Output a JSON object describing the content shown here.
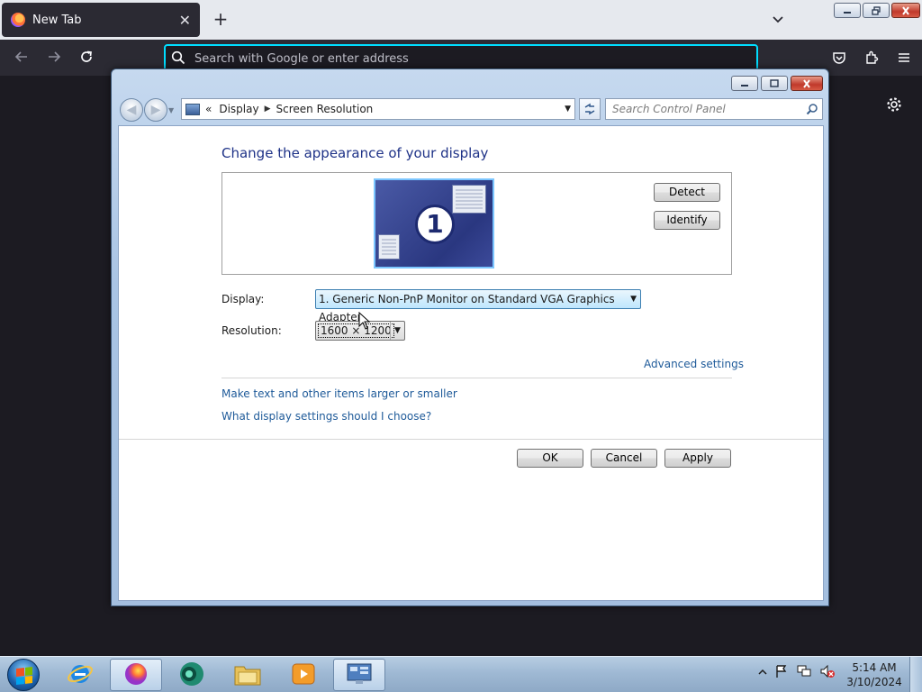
{
  "browser": {
    "tab_title": "New Tab",
    "tab_close": "✕",
    "new_tab_label": "+",
    "url_placeholder": "Search with Google or enter address"
  },
  "window": {
    "breadcrumb": [
      "«",
      "Display",
      "Screen Resolution"
    ],
    "search_placeholder": "Search Control Panel"
  },
  "content": {
    "title": "Change the appearance of your display",
    "monitor_number": "1",
    "detect_label": "Detect",
    "identify_label": "Identify",
    "display_label": "Display:",
    "display_value": "1. Generic Non-PnP Monitor on Standard VGA Graphics Adapter",
    "resolution_label": "Resolution:",
    "resolution_value": "1600 × 1200",
    "advanced_link": "Advanced settings",
    "link_text_size": "Make text and other items larger or smaller",
    "link_what_settings": "What display settings should I choose?",
    "ok_label": "OK",
    "cancel_label": "Cancel",
    "apply_label": "Apply"
  },
  "taskbar": {
    "apps": [
      "internet-explorer",
      "firefox",
      "media-center",
      "windows-explorer",
      "media-player",
      "control-panel"
    ],
    "time": "5:14 AM",
    "date": "3/10/2024"
  },
  "colors": {
    "browser_dark": "#2b2a33",
    "url_focus": "#00ddff",
    "title_blue": "#1e3287",
    "link_blue": "#1e5a99"
  }
}
